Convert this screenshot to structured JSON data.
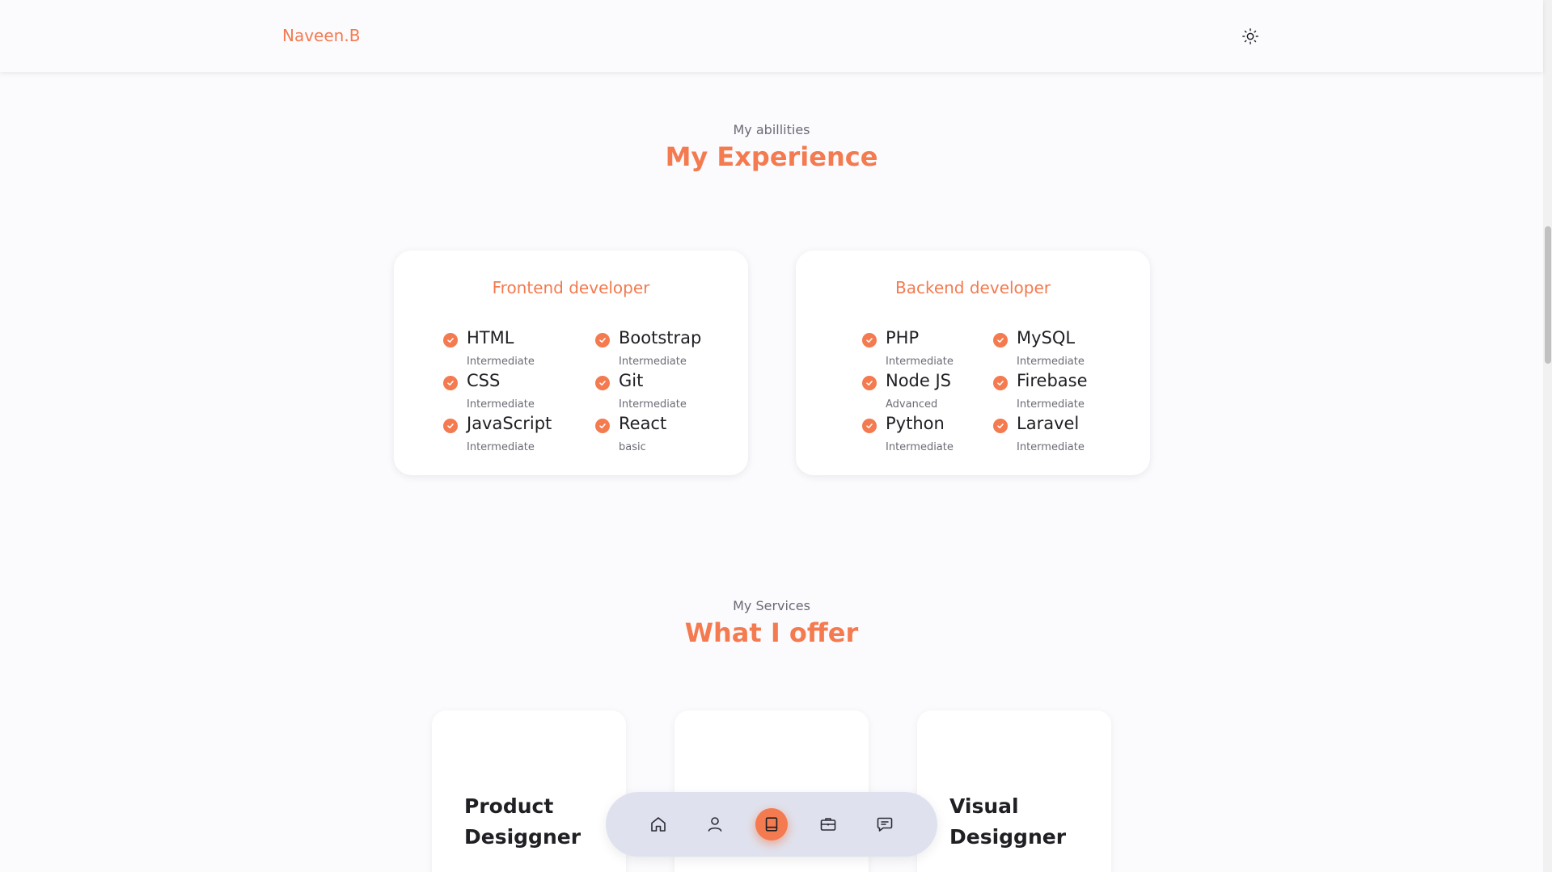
{
  "header": {
    "logo": "Naveen.B",
    "theme_icon": "sun-icon"
  },
  "experience": {
    "subtitle": "My abillities",
    "title": "My Experience",
    "frontend": {
      "title": "Frontend developer",
      "skills": [
        {
          "name": "HTML",
          "level": "Intermediate"
        },
        {
          "name": "Bootstrap",
          "level": "Intermediate"
        },
        {
          "name": "CSS",
          "level": "Intermediate"
        },
        {
          "name": "Git",
          "level": "Intermediate"
        },
        {
          "name": "JavaScript",
          "level": "Intermediate"
        },
        {
          "name": "React",
          "level": "basic"
        }
      ]
    },
    "backend": {
      "title": "Backend developer",
      "skills": [
        {
          "name": "PHP",
          "level": "Intermediate"
        },
        {
          "name": "MySQL",
          "level": "Intermediate"
        },
        {
          "name": "Node JS",
          "level": "Advanced"
        },
        {
          "name": "Firebase",
          "level": "Intermediate"
        },
        {
          "name": "Python",
          "level": "Intermediate"
        },
        {
          "name": "Laravel",
          "level": "Intermediate"
        }
      ]
    }
  },
  "services": {
    "subtitle": "My Services",
    "title": "What I offer",
    "cards": [
      {
        "title": "Product Desiggner"
      },
      {
        "title": ""
      },
      {
        "title": "Visual Desiggner"
      }
    ]
  },
  "bottom_nav": {
    "items": [
      {
        "icon": "home-icon"
      },
      {
        "icon": "user-icon"
      },
      {
        "icon": "book-icon",
        "active": true
      },
      {
        "icon": "briefcase-icon"
      },
      {
        "icon": "message-icon"
      }
    ]
  },
  "colors": {
    "accent": "#f47a4f",
    "background": "#fbfbfe",
    "nav_background": "#dfe2ee"
  }
}
